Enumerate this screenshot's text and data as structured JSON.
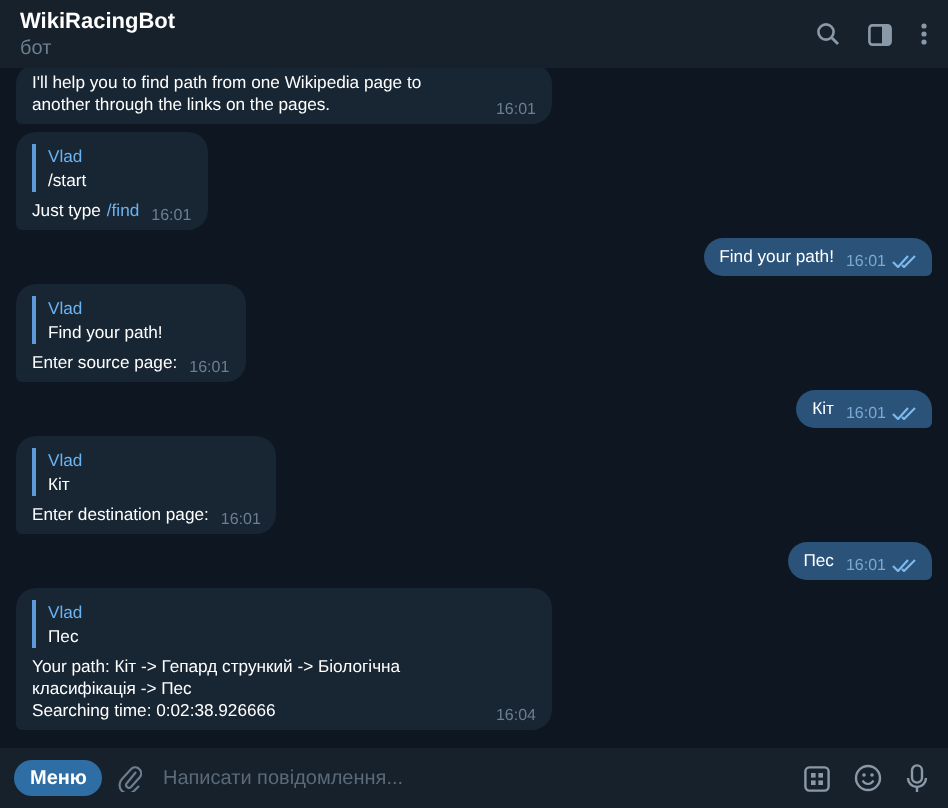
{
  "header": {
    "title": "WikiRacingBot",
    "subtitle": "бот"
  },
  "messages": [
    {
      "kind": "incoming",
      "lines": [
        "I'll help you to find path from one Wikipedia page to another through the links on the pages."
      ],
      "time": "16:01"
    },
    {
      "kind": "incoming",
      "reply": {
        "author": "Vlad",
        "text": "/start"
      },
      "lines": [
        "Just type"
      ],
      "command": "/find",
      "time": "16:01"
    },
    {
      "kind": "outgoing",
      "lines": [
        "Find your path!"
      ],
      "time": "16:01",
      "read": true
    },
    {
      "kind": "incoming",
      "reply": {
        "author": "Vlad",
        "text": "Find your path!"
      },
      "lines": [
        "Enter source page:"
      ],
      "time": "16:01"
    },
    {
      "kind": "outgoing",
      "lines": [
        "Кіт"
      ],
      "time": "16:01",
      "read": true
    },
    {
      "kind": "incoming",
      "reply": {
        "author": "Vlad",
        "text": "Кіт"
      },
      "lines": [
        "Enter destination page:"
      ],
      "time": "16:01"
    },
    {
      "kind": "outgoing",
      "lines": [
        "Пес"
      ],
      "time": "16:01",
      "read": true
    },
    {
      "kind": "incoming",
      "reply": {
        "author": "Vlad",
        "text": "Пес"
      },
      "lines": [
        "Your path: Кіт -> Гепард стрункий -> Біологічна класифікація -> Пес",
        "Searching time: 0:02:38.926666"
      ],
      "time": "16:04"
    }
  ],
  "composer": {
    "menu_button": "Меню",
    "placeholder": "Написати повідомлення..."
  }
}
